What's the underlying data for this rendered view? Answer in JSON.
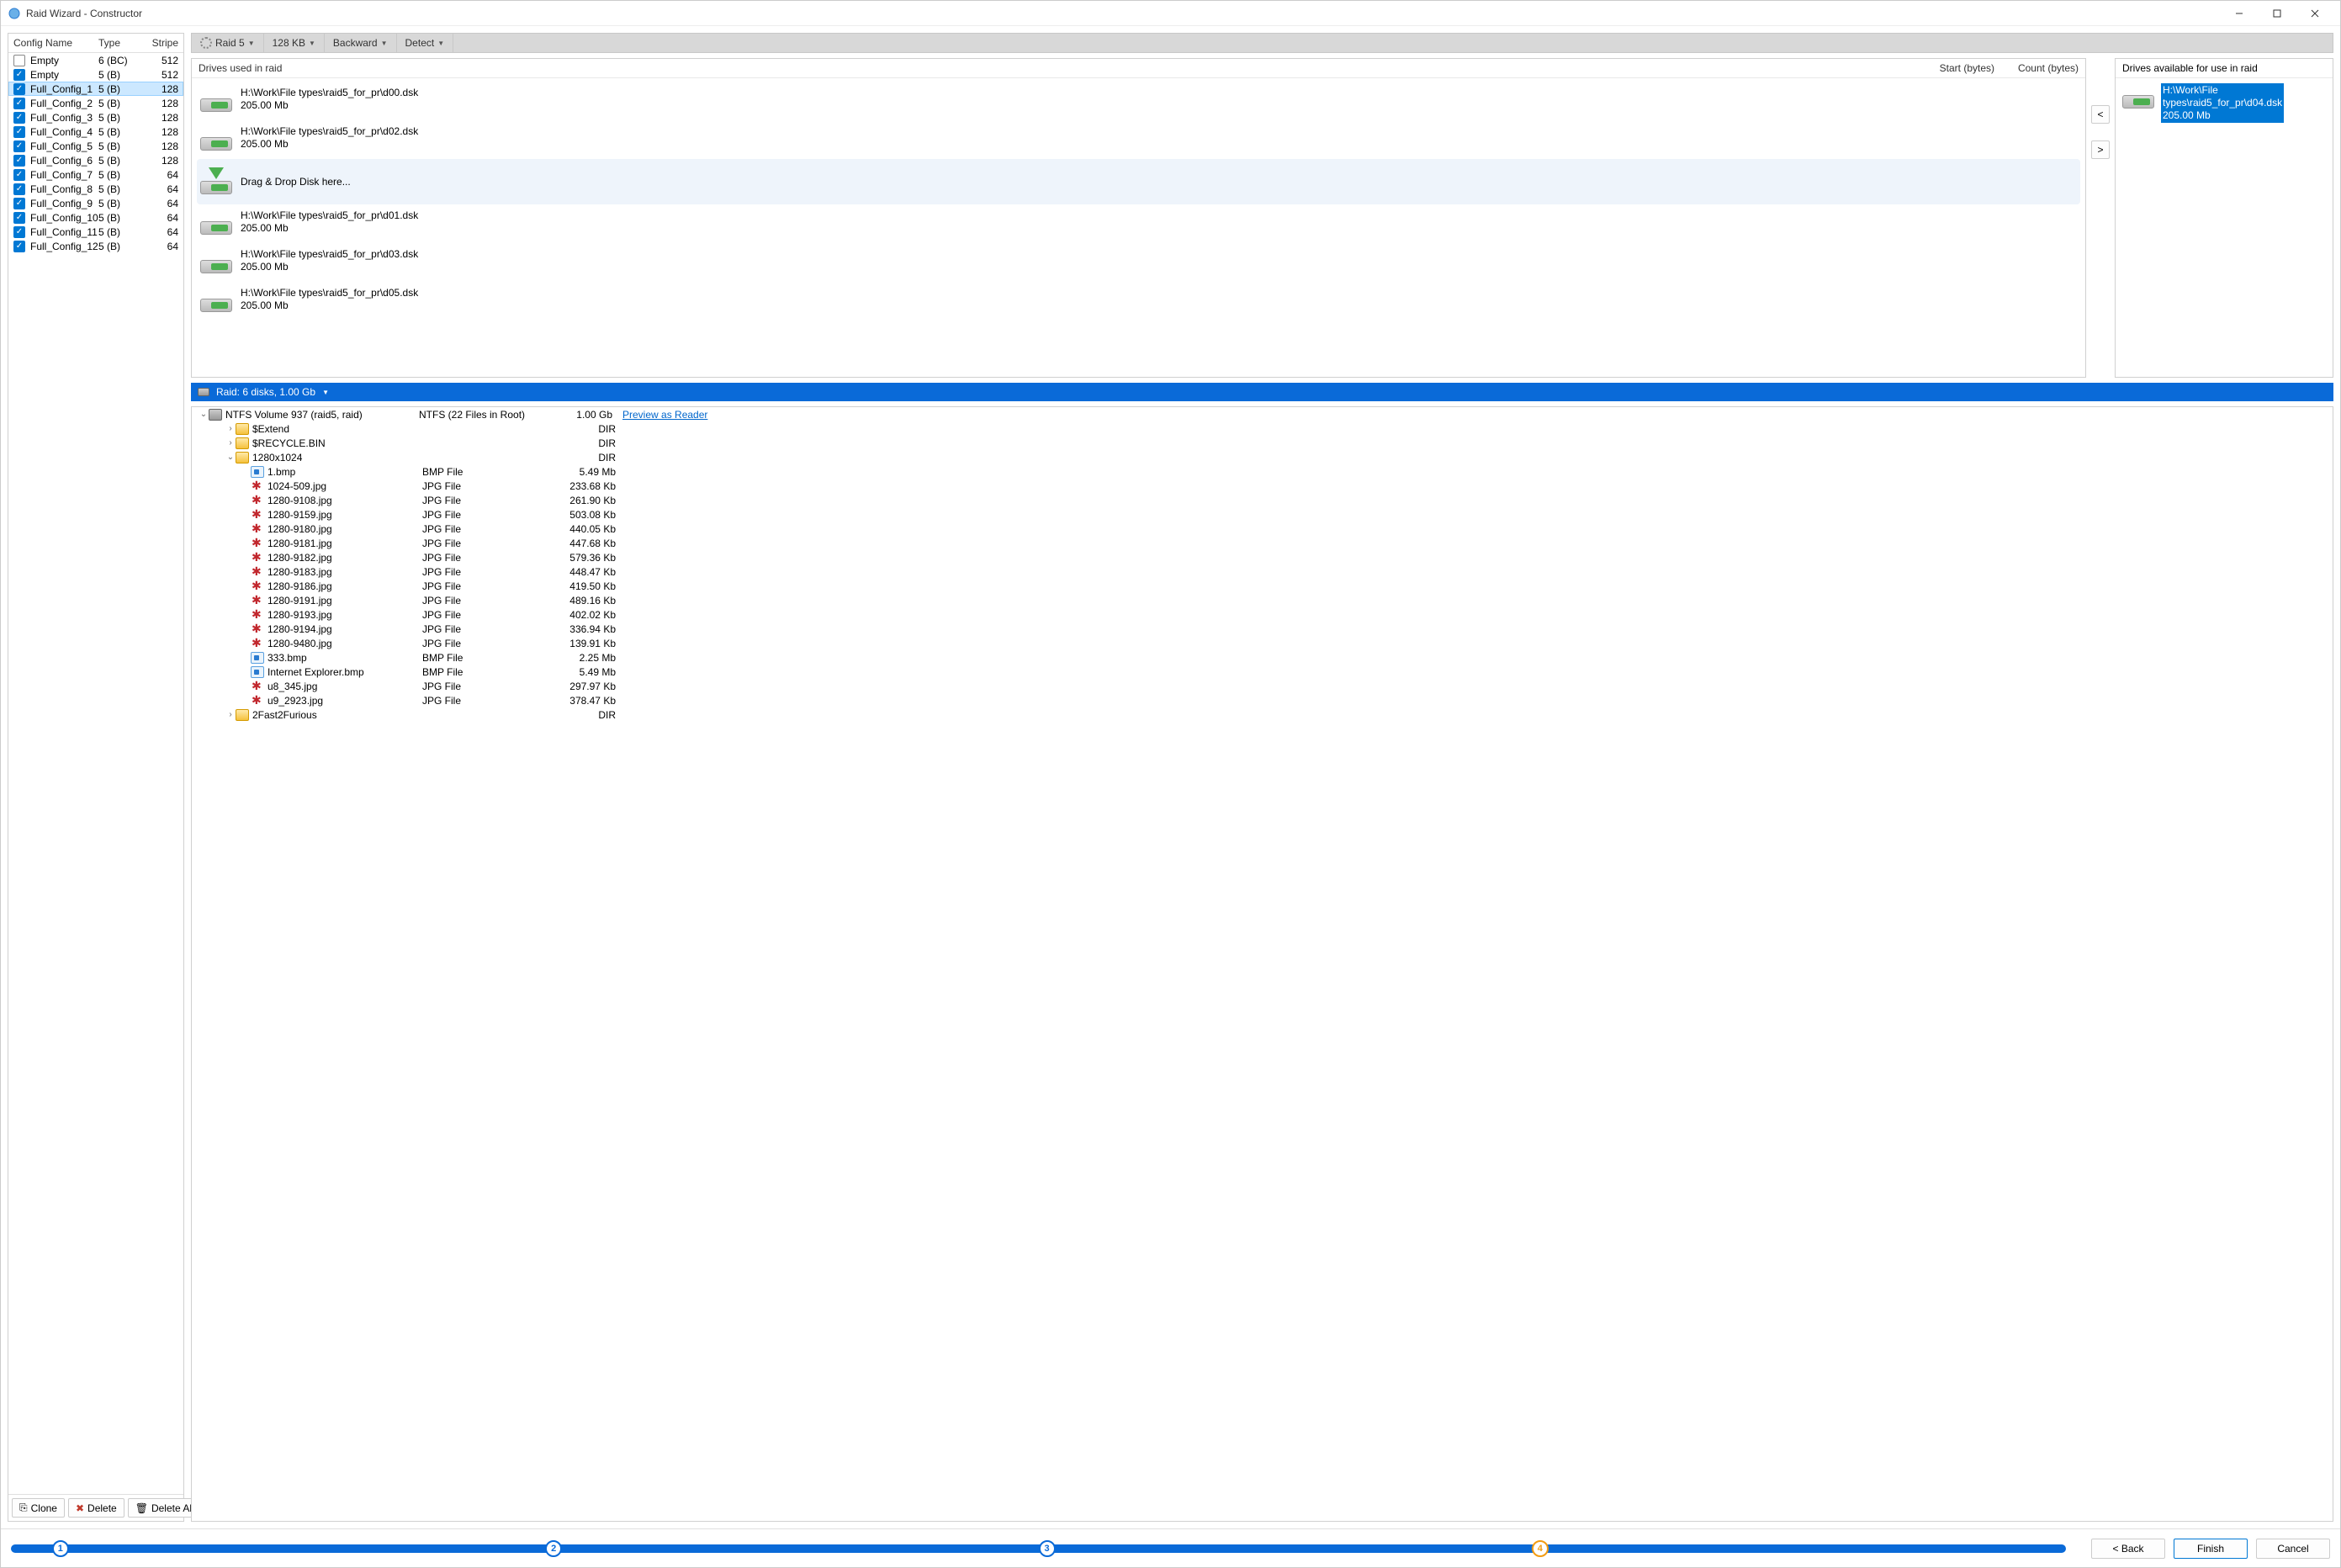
{
  "window": {
    "title": "Raid Wizard - Constructor"
  },
  "config": {
    "headers": {
      "name": "Config Name",
      "type": "Type",
      "stripe": "Stripe"
    },
    "rows": [
      {
        "checked": false,
        "selected": false,
        "name": "Empty",
        "type": "6 (BC)",
        "stripe": "512"
      },
      {
        "checked": true,
        "selected": false,
        "name": "Empty",
        "type": "5 (B)",
        "stripe": "512"
      },
      {
        "checked": true,
        "selected": true,
        "name": "Full_Config_1",
        "type": "5 (B)",
        "stripe": "128"
      },
      {
        "checked": true,
        "selected": false,
        "name": "Full_Config_2",
        "type": "5 (B)",
        "stripe": "128"
      },
      {
        "checked": true,
        "selected": false,
        "name": "Full_Config_3",
        "type": "5 (B)",
        "stripe": "128"
      },
      {
        "checked": true,
        "selected": false,
        "name": "Full_Config_4",
        "type": "5 (B)",
        "stripe": "128"
      },
      {
        "checked": true,
        "selected": false,
        "name": "Full_Config_5",
        "type": "5 (B)",
        "stripe": "128"
      },
      {
        "checked": true,
        "selected": false,
        "name": "Full_Config_6",
        "type": "5 (B)",
        "stripe": "128"
      },
      {
        "checked": true,
        "selected": false,
        "name": "Full_Config_7",
        "type": "5 (B)",
        "stripe": "64"
      },
      {
        "checked": true,
        "selected": false,
        "name": "Full_Config_8",
        "type": "5 (B)",
        "stripe": "64"
      },
      {
        "checked": true,
        "selected": false,
        "name": "Full_Config_9",
        "type": "5 (B)",
        "stripe": "64"
      },
      {
        "checked": true,
        "selected": false,
        "name": "Full_Config_10",
        "type": "5 (B)",
        "stripe": "64"
      },
      {
        "checked": true,
        "selected": false,
        "name": "Full_Config_11",
        "type": "5 (B)",
        "stripe": "64"
      },
      {
        "checked": true,
        "selected": false,
        "name": "Full_Config_12",
        "type": "5 (B)",
        "stripe": "64"
      }
    ],
    "buttons": {
      "clone": "Clone",
      "delete": "Delete",
      "deleteAll": "Delete All"
    }
  },
  "toolbar": {
    "raidType": "Raid 5",
    "stripe": "128 KB",
    "direction": "Backward",
    "detect": "Detect"
  },
  "drivesUsed": {
    "headers": {
      "h1": "Drives used in raid",
      "h2": "Start (bytes)",
      "h3": "Count (bytes)"
    },
    "items": [
      {
        "path": "H:\\Work\\File types\\raid5_for_pr\\d00.dsk",
        "size": "205.00 Mb",
        "drop": false
      },
      {
        "path": "H:\\Work\\File types\\raid5_for_pr\\d02.dsk",
        "size": "205.00 Mb",
        "drop": false
      },
      {
        "path": "Drag & Drop Disk here...",
        "size": "",
        "drop": true
      },
      {
        "path": "H:\\Work\\File types\\raid5_for_pr\\d01.dsk",
        "size": "205.00 Mb",
        "drop": false
      },
      {
        "path": "H:\\Work\\File types\\raid5_for_pr\\d03.dsk",
        "size": "205.00 Mb",
        "drop": false
      },
      {
        "path": "H:\\Work\\File types\\raid5_for_pr\\d05.dsk",
        "size": "205.00 Mb",
        "drop": false
      }
    ]
  },
  "moveButtons": {
    "left": "<",
    "right": ">"
  },
  "drivesAvail": {
    "header": "Drives available for use in raid",
    "items": [
      {
        "line1": "H:\\Work\\File",
        "line2": "types\\raid5_for_pr\\d04.dsk",
        "line3": "205.00 Mb"
      }
    ]
  },
  "raidBar": {
    "label": "Raid: 6 disks, 1.00 Gb"
  },
  "fileTree": {
    "root": {
      "name": "NTFS Volume 937 (raid5, raid)",
      "type": "NTFS (22 Files in Root)",
      "size": "1.00 Gb",
      "link": "Preview as Reader"
    },
    "rows": [
      {
        "indent": 1,
        "expander": ">",
        "icon": "folder",
        "name": "$Extend",
        "type": "",
        "size": "DIR"
      },
      {
        "indent": 1,
        "expander": ">",
        "icon": "folder",
        "name": "$RECYCLE.BIN",
        "type": "",
        "size": "DIR"
      },
      {
        "indent": 1,
        "expander": "v",
        "icon": "folder",
        "name": "1280x1024",
        "type": "",
        "size": "DIR"
      },
      {
        "indent": 2,
        "expander": "",
        "icon": "bmp",
        "name": "1.bmp",
        "type": "BMP File",
        "size": "5.49 Mb"
      },
      {
        "indent": 2,
        "expander": "",
        "icon": "jpg",
        "name": "1024-509.jpg",
        "type": "JPG File",
        "size": "233.68 Kb"
      },
      {
        "indent": 2,
        "expander": "",
        "icon": "jpg",
        "name": "1280-9108.jpg",
        "type": "JPG File",
        "size": "261.90 Kb"
      },
      {
        "indent": 2,
        "expander": "",
        "icon": "jpg",
        "name": "1280-9159.jpg",
        "type": "JPG File",
        "size": "503.08 Kb"
      },
      {
        "indent": 2,
        "expander": "",
        "icon": "jpg",
        "name": "1280-9180.jpg",
        "type": "JPG File",
        "size": "440.05 Kb"
      },
      {
        "indent": 2,
        "expander": "",
        "icon": "jpg",
        "name": "1280-9181.jpg",
        "type": "JPG File",
        "size": "447.68 Kb"
      },
      {
        "indent": 2,
        "expander": "",
        "icon": "jpg",
        "name": "1280-9182.jpg",
        "type": "JPG File",
        "size": "579.36 Kb"
      },
      {
        "indent": 2,
        "expander": "",
        "icon": "jpg",
        "name": "1280-9183.jpg",
        "type": "JPG File",
        "size": "448.47 Kb"
      },
      {
        "indent": 2,
        "expander": "",
        "icon": "jpg",
        "name": "1280-9186.jpg",
        "type": "JPG File",
        "size": "419.50 Kb"
      },
      {
        "indent": 2,
        "expander": "",
        "icon": "jpg",
        "name": "1280-9191.jpg",
        "type": "JPG File",
        "size": "489.16 Kb"
      },
      {
        "indent": 2,
        "expander": "",
        "icon": "jpg",
        "name": "1280-9193.jpg",
        "type": "JPG File",
        "size": "402.02 Kb"
      },
      {
        "indent": 2,
        "expander": "",
        "icon": "jpg",
        "name": "1280-9194.jpg",
        "type": "JPG File",
        "size": "336.94 Kb"
      },
      {
        "indent": 2,
        "expander": "",
        "icon": "jpg",
        "name": "1280-9480.jpg",
        "type": "JPG File",
        "size": "139.91 Kb"
      },
      {
        "indent": 2,
        "expander": "",
        "icon": "bmp",
        "name": "333.bmp",
        "type": "BMP File",
        "size": "2.25 Mb"
      },
      {
        "indent": 2,
        "expander": "",
        "icon": "bmp",
        "name": "Internet Explorer.bmp",
        "type": "BMP File",
        "size": "5.49 Mb"
      },
      {
        "indent": 2,
        "expander": "",
        "icon": "jpg",
        "name": "u8_345.jpg",
        "type": "JPG File",
        "size": "297.97 Kb"
      },
      {
        "indent": 2,
        "expander": "",
        "icon": "jpg",
        "name": "u9_2923.jpg",
        "type": "JPG File",
        "size": "378.47 Kb"
      },
      {
        "indent": 1,
        "expander": ">",
        "icon": "folder",
        "name": "2Fast2Furious",
        "type": "",
        "size": "DIR"
      }
    ]
  },
  "footer": {
    "steps": {
      "s1": "1",
      "s2": "2",
      "s3": "3",
      "s4": "4"
    },
    "back": "< Back",
    "finish": "Finish",
    "cancel": "Cancel"
  }
}
